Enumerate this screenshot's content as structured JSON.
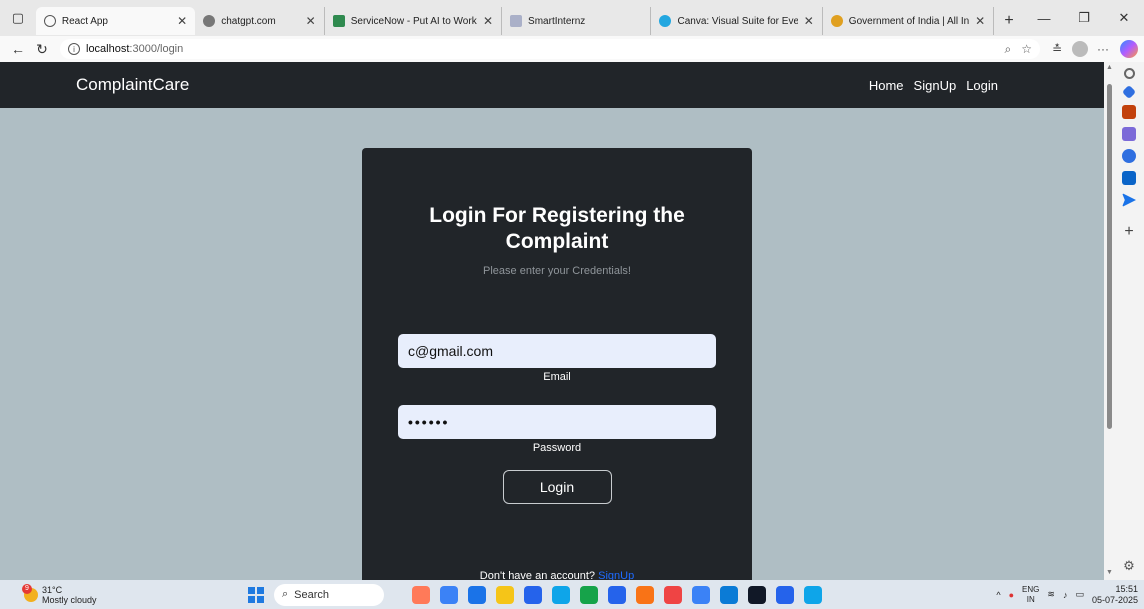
{
  "browser": {
    "tabs": [
      {
        "title": "React App",
        "active": true,
        "color": "#555555"
      },
      {
        "title": "chatgpt.com",
        "active": false,
        "color": "#777777"
      },
      {
        "title": "ServiceNow - Put AI to Work",
        "active": false,
        "color": "#2f8a4f"
      },
      {
        "title": "SmartInternz",
        "active": false,
        "color": "#aab0c8"
      },
      {
        "title": "Canva: Visual Suite for Every",
        "active": false,
        "color": "#23a7e0"
      },
      {
        "title": "Government of India | All Ini",
        "active": false,
        "color": "#e0a020"
      }
    ],
    "url_host": "localhost",
    "url_path": ":3000/login"
  },
  "app": {
    "brand": "ComplaintCare",
    "nav": [
      "Home",
      "SignUp",
      "Login"
    ],
    "title": "Login For Registering the Complaint",
    "subtitle": "Please enter your Credentials!",
    "email_value": "c@gmail.com",
    "email_label": "Email",
    "password_value": "••••••",
    "password_label": "Password",
    "login_button": "Login",
    "signup_prompt": "Don't have an account?",
    "signup_link": "SignUp"
  },
  "sidebar": {
    "icons": [
      {
        "name": "search-icon",
        "color": "#666666"
      },
      {
        "name": "tag-icon",
        "color": "#2f6fe0"
      },
      {
        "name": "briefcase-icon",
        "color": "#c2410c"
      },
      {
        "name": "games-icon",
        "color": "#7c6ad8"
      },
      {
        "name": "copilot-icon",
        "color": "#2f6fe0"
      },
      {
        "name": "outlook-icon",
        "color": "#0a64c8"
      },
      {
        "name": "send-icon",
        "color": "#1a73e8"
      }
    ]
  },
  "taskbar": {
    "temp": "31°C",
    "weather": "Mostly cloudy",
    "weather_badge": "9",
    "search": "Search",
    "lang_top": "ENG",
    "lang_bottom": "IN",
    "time": "15:51",
    "date": "05-07-2025",
    "apps": [
      "#ff7a59",
      "#3b82f6",
      "#1a73e8",
      "#f5c518",
      "#2563eb",
      "#0ea5e9",
      "#16a34a",
      "#2563eb",
      "#f97316",
      "#ef4444",
      "#3b82f6",
      "#0b7bd6",
      "#111827",
      "#2563eb",
      "#0ea5e9"
    ]
  }
}
